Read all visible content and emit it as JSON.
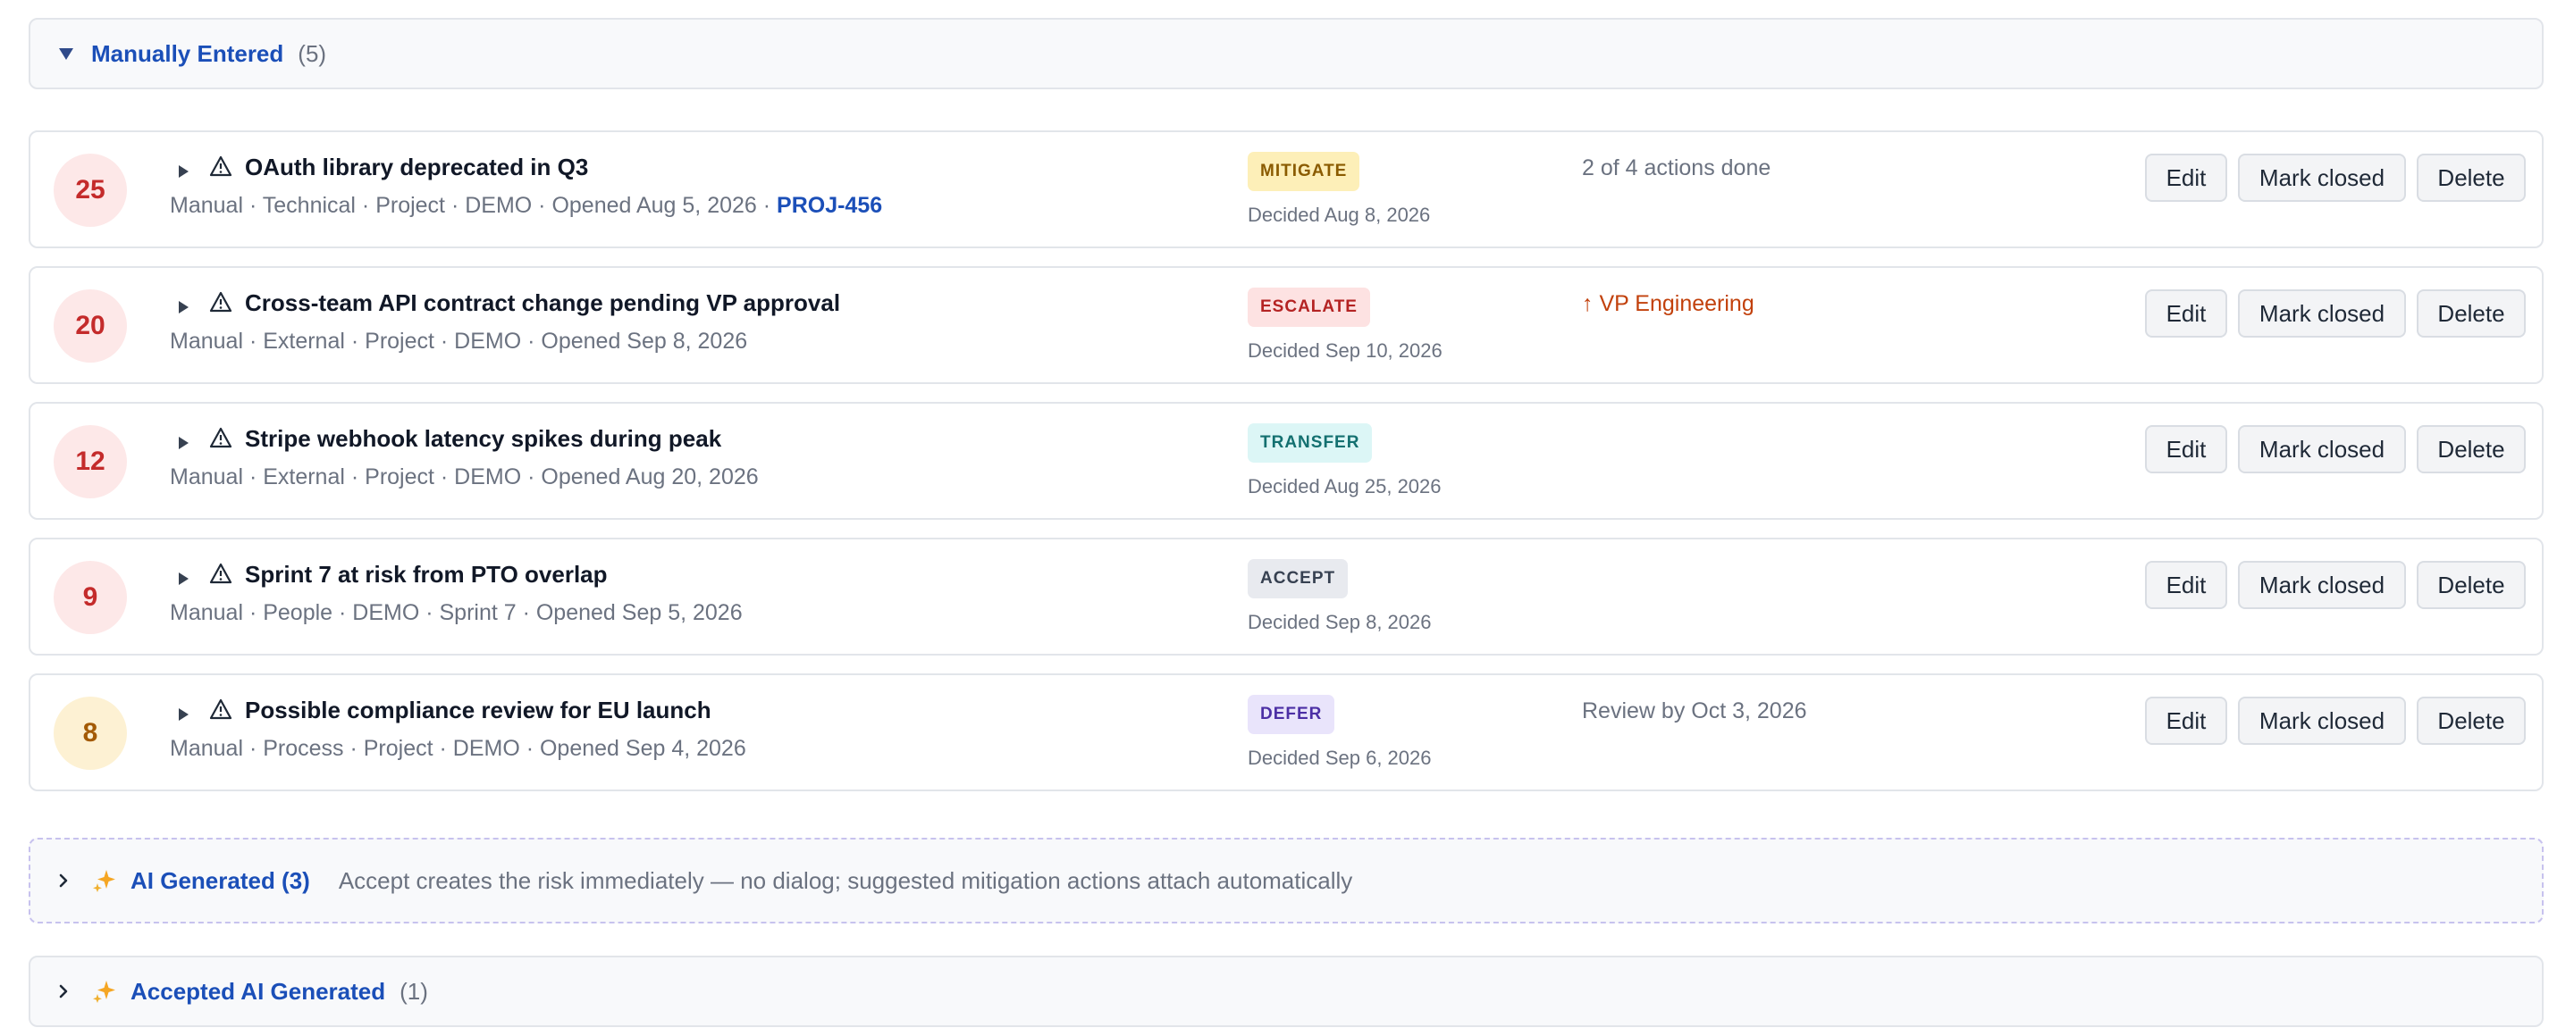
{
  "sections": {
    "manual": {
      "title": "Manually Entered",
      "count": "(5)"
    },
    "ai": {
      "title": "AI Generated (3)",
      "note": "Accept creates the risk immediately — no dialog; suggested mitigation actions attach automatically"
    },
    "accepted": {
      "title": "Accepted AI Generated",
      "count": "(1)"
    }
  },
  "buttons": {
    "edit": "Edit",
    "mark_closed": "Mark closed",
    "delete": "Delete"
  },
  "risks": [
    {
      "score": "25",
      "title": "OAuth library deprecated in Q3",
      "meta": "Manual · Technical · Project · DEMO · Opened Aug 5, 2026 · ",
      "link": "PROJ-456",
      "decision": "MITIGATE",
      "decided": "Decided Aug 8, 2026",
      "note": "2 of 4 actions done"
    },
    {
      "score": "20",
      "title": "Cross-team API contract change pending VP approval",
      "meta": "Manual · External · Project · DEMO · Opened Sep 8, 2026",
      "decision": "ESCALATE",
      "decided": "Decided Sep 10, 2026",
      "note": "↑ VP Engineering"
    },
    {
      "score": "12",
      "title": "Stripe webhook latency spikes during peak",
      "meta": "Manual · External · Project · DEMO · Opened Aug 20, 2026",
      "decision": "TRANSFER",
      "decided": "Decided Aug 25, 2026",
      "note": ""
    },
    {
      "score": "9",
      "title": "Sprint 7 at risk from PTO overlap",
      "meta": "Manual · People · DEMO · Sprint 7 · Opened Sep 5, 2026",
      "decision": "ACCEPT",
      "decided": "Decided Sep 8, 2026",
      "note": ""
    },
    {
      "score": "8",
      "title": "Possible compliance review for EU launch",
      "meta": "Manual · Process · Project · DEMO · Opened Sep 4, 2026",
      "decision": "DEFER",
      "decided": "Decided Sep 6, 2026",
      "note": "Review by Oct 3, 2026"
    }
  ],
  "colors": {
    "link": "#1b4fb8",
    "score_red": "#c42b2b",
    "score_amber": "#a35a05",
    "escalate_note": "#c2410c"
  }
}
